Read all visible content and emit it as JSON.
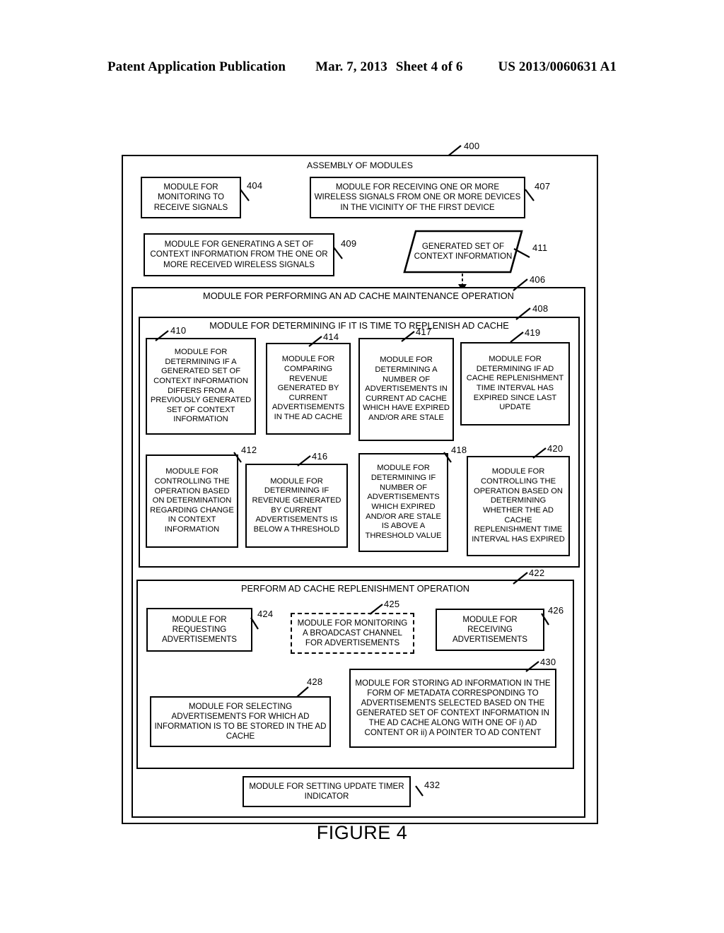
{
  "header": {
    "publication": "Patent Application Publication",
    "date": "Mar. 7, 2013",
    "sheet": "Sheet 4 of 6",
    "patent_number": "US 2013/0060631 A1"
  },
  "figure": {
    "caption": "FIGURE 4",
    "assembly_ref": "400",
    "assembly_title": "ASSEMBLY OF MODULES"
  },
  "modules": {
    "m404": {
      "ref": "404",
      "text": "MODULE FOR MONITORING TO RECEIVE SIGNALS"
    },
    "m407": {
      "ref": "407",
      "text": "MODULE FOR RECEIVING ONE OR MORE WIRELESS SIGNALS FROM ONE OR MORE DEVICES IN THE VICINITY OF THE FIRST DEVICE"
    },
    "m409": {
      "ref": "409",
      "text": "MODULE FOR GENERATING A SET OF CONTEXT INFORMATION FROM THE ONE OR MORE RECEIVED WIRELESS SIGNALS"
    },
    "m411": {
      "ref": "411",
      "text": "GENERATED SET OF CONTEXT INFORMATION",
      "shape": "parallelogram"
    },
    "m406": {
      "ref": "406",
      "text": "MODULE FOR PERFORMING AN AD CACHE MAINTENANCE OPERATION"
    },
    "m408": {
      "ref": "408",
      "text": "MODULE FOR DETERMINING IF IT IS TIME TO REPLENISH AD CACHE"
    },
    "m410": {
      "ref": "410",
      "text": "MODULE FOR DETERMINING IF A GENERATED SET OF CONTEXT INFORMATION DIFFERS FROM A PREVIOUSLY GENERATED SET OF CONTEXT INFORMATION"
    },
    "m414": {
      "ref": "414",
      "text": "MODULE FOR COMPARING REVENUE GENERATED BY CURRENT ADVERTISEMENTS IN THE AD CACHE"
    },
    "m417": {
      "ref": "417",
      "text": "MODULE FOR DETERMINING A NUMBER OF ADVERTISEMENTS IN CURRENT AD CACHE WHICH HAVE EXPIRED AND/OR ARE STALE"
    },
    "m419": {
      "ref": "419",
      "text": "MODULE FOR DETERMINING IF AD CACHE REPLENISHMENT TIME INTERVAL HAS EXPIRED SINCE LAST UPDATE"
    },
    "m412": {
      "ref": "412",
      "text": "MODULE FOR CONTROLLING THE OPERATION BASED ON DETERMINATION REGARDING CHANGE IN CONTEXT INFORMATION"
    },
    "m416": {
      "ref": "416",
      "text": "MODULE FOR DETERMINING IF REVENUE GENERATED BY CURRENT ADVERTISEMENTS IS BELOW A THRESHOLD"
    },
    "m418": {
      "ref": "418",
      "text": "MODULE FOR DETERMINING IF NUMBER OF ADVERTISEMENTS WHICH EXPIRED AND/OR ARE STALE IS ABOVE A THRESHOLD VALUE"
    },
    "m420": {
      "ref": "420",
      "text": "MODULE FOR CONTROLLING THE OPERATION BASED ON DETERMINING WHETHER THE AD CACHE REPLENISHMENT TIME INTERVAL HAS EXPIRED"
    },
    "m422": {
      "ref": "422",
      "text": "PERFORM AD CACHE REPLENISHMENT OPERATION"
    },
    "m424": {
      "ref": "424",
      "text": "MODULE FOR REQUESTING ADVERTISEMENTS"
    },
    "m425": {
      "ref": "425",
      "text": "MODULE FOR MONITORING A BROADCAST CHANNEL FOR ADVERTISEMENTS",
      "border": "dashed"
    },
    "m426": {
      "ref": "426",
      "text": "MODULE FOR RECEIVING ADVERTISEMENTS"
    },
    "m428": {
      "ref": "428",
      "text": "MODULE FOR SELECTING ADVERTISEMENTS FOR WHICH AD INFORMATION IS TO BE STORED IN THE AD CACHE"
    },
    "m430": {
      "ref": "430",
      "text": "MODULE FOR STORING AD INFORMATION IN THE FORM OF METADATA CORRESPONDING TO ADVERTISEMENTS SELECTED BASED ON THE GENERATED SET OF CONTEXT INFORMATION IN THE AD CACHE ALONG WITH ONE OF i) AD CONTENT OR ii) A POINTER TO AD CONTENT"
    },
    "m432": {
      "ref": "432",
      "text": "MODULE FOR SETTING UPDATE TIMER INDICATOR"
    }
  }
}
